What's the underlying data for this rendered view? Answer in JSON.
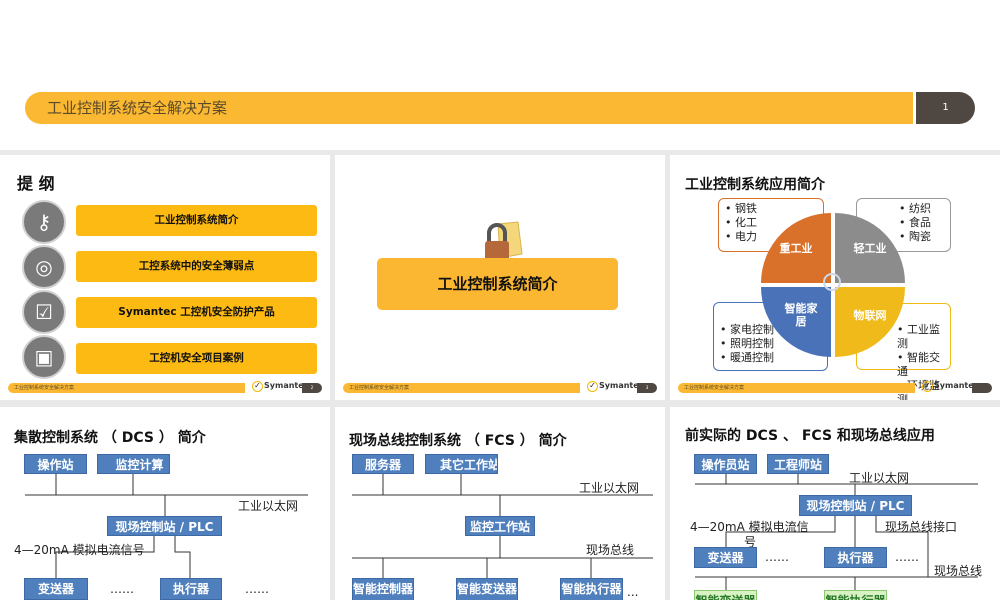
{
  "slide1": {
    "title": "工业控制系统安全解决方案",
    "page": "1"
  },
  "footer": {
    "text": "工业控制系统安全解决方案",
    "brand": "Symantec.",
    "brand_mark": "✓"
  },
  "slide2": {
    "title": "提 纲",
    "page": "2",
    "items": [
      {
        "label": "工业控制系统简介",
        "icon": "keys-icon"
      },
      {
        "label": "工控系统中的安全薄弱点",
        "icon": "target-icon"
      },
      {
        "label": "Symantec 工控机安全防护产品",
        "icon": "shield-check-icon"
      },
      {
        "label": "工控机安全项目案例",
        "icon": "monitor-chart-icon"
      }
    ]
  },
  "slide3": {
    "title": "工业控制系统简介",
    "page": "3"
  },
  "slide4": {
    "title": "工业控制系统应用简介",
    "quadrants": [
      {
        "label": "重工业",
        "items": [
          "钢铁",
          "化工",
          "电力"
        ],
        "color": "#D9712B"
      },
      {
        "label": "轻工业",
        "items": [
          "纺织",
          "食品",
          "陶瓷"
        ],
        "color": "#8C8C8C"
      },
      {
        "label": "智能家居",
        "items": [
          "家电控制",
          "照明控制",
          "暖通控制"
        ],
        "color": "#4A72B8"
      },
      {
        "label": "物联网",
        "items": [
          "工业监测",
          "智能交通",
          "环境监测"
        ],
        "color": "#F0BB1A"
      }
    ]
  },
  "slide5": {
    "title": "集散控制系统 （ DCS ） 简介",
    "op_station": "操作站",
    "monitor": "监控计算",
    "ethernet": "工业以太网",
    "plc": "现场控制站 / PLC",
    "signal": "4—20mA 模拟电流信号",
    "transmitter": "变送器",
    "actuator": "执行器",
    "ellipsis": "……"
  },
  "slide6": {
    "title": "现场总线控制系统 （ FCS ） 简介",
    "server": "服务器",
    "other": "其它工作站",
    "ethernet": "工业以太网",
    "monitor": "监控工作站",
    "fieldbus": "现场总线",
    "smart_controller": "智能控制器",
    "smart_transmitter": "智能变送器",
    "smart_actuator": "智能执行器",
    "ellipsis": "..."
  },
  "slide7": {
    "title": "前实际的 DCS 、 FCS 和现场总线应用",
    "operator": "操作员站",
    "engineer": "工程师站",
    "ethernet": "工业以太网",
    "plc": "现场控制站 / PLC",
    "signal_a": "4—20mA 模拟电流信",
    "signal_b": "号",
    "fieldbus_if": "现场总线接口",
    "transmitter": "变送器",
    "actuator": "执行器",
    "ellipsis": "……",
    "fieldbus": "现场总线",
    "smart_transmitter": "智能变送器",
    "smart_actuator": "智能执行器"
  }
}
